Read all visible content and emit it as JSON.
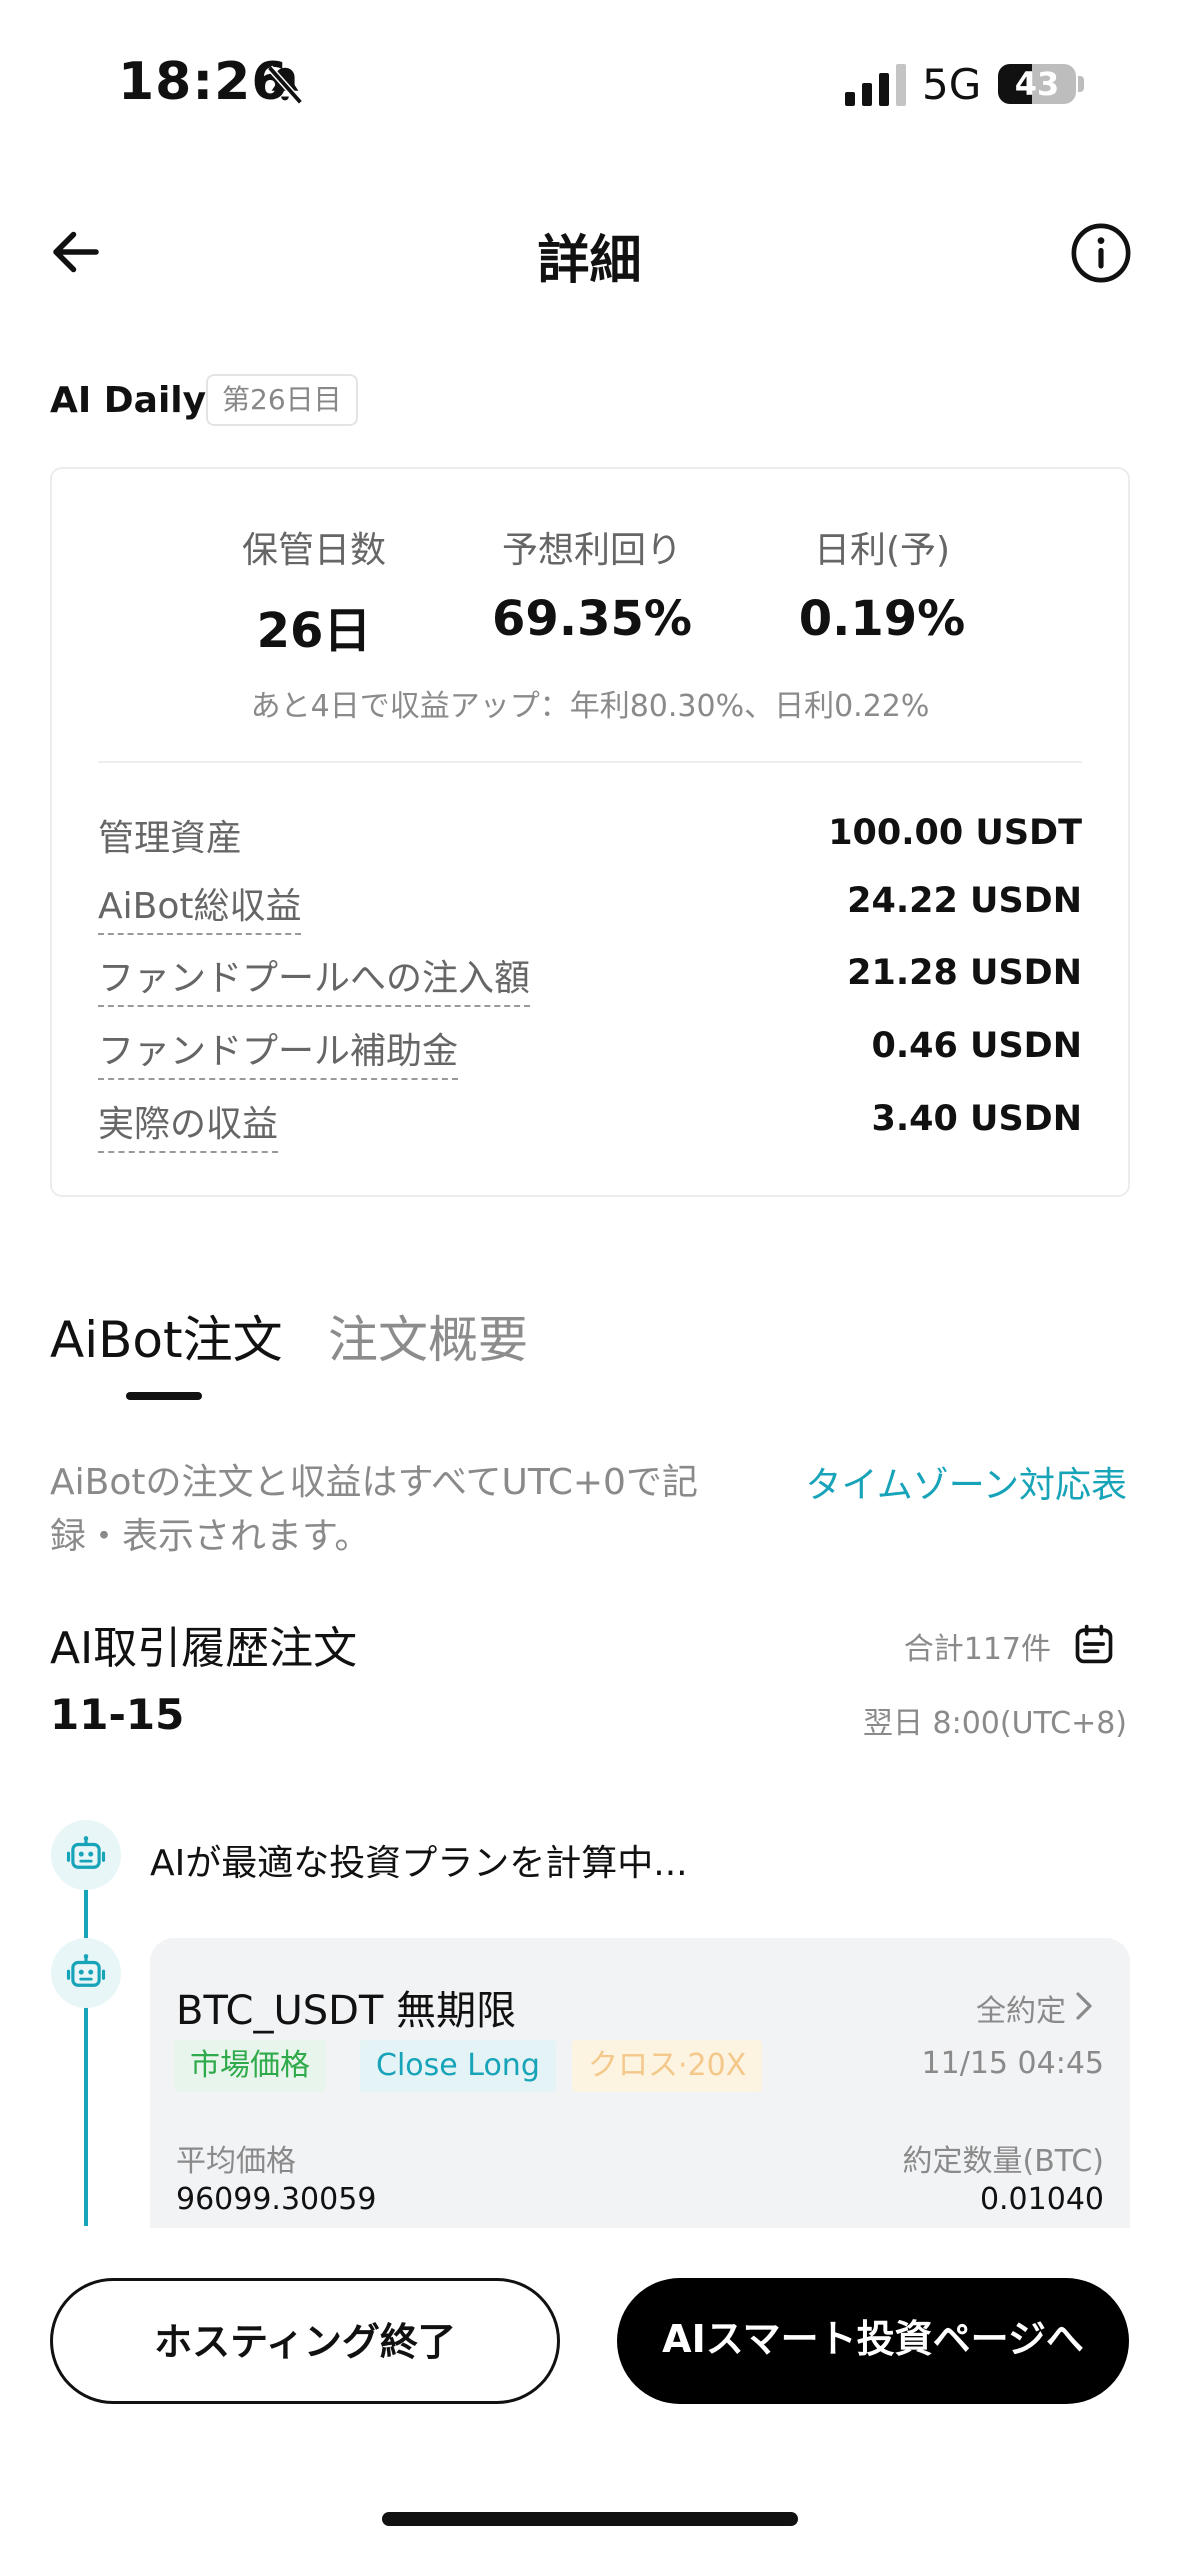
{
  "status_bar": {
    "time": "18:26",
    "network": "5G",
    "battery": "43",
    "battery_level": 0.43
  },
  "nav": {
    "title": "詳細"
  },
  "bot": {
    "name": "AI Daily",
    "day_badge": "第26日目"
  },
  "stats": [
    {
      "label": "保管日数",
      "value": "26日"
    },
    {
      "label": "予想利回り",
      "value": "69.35%"
    },
    {
      "label": "日利(予)",
      "value": "0.19%"
    }
  ],
  "hint": "あと4日で収益アップ：年利80.30%、日利0.22%",
  "details": [
    {
      "label": "管理資産",
      "value": "100.00 USDT"
    },
    {
      "label": "AiBot総収益",
      "value": "24.22 USDN"
    },
    {
      "label": "ファンドプールへの注入額",
      "value": "21.28 USDN"
    },
    {
      "label": "ファンドプール補助金",
      "value": "0.46 USDN"
    },
    {
      "label": "実際の収益",
      "value": "3.40 USDN"
    }
  ],
  "tabs": {
    "orders": "AiBot注文",
    "overview": "注文概要"
  },
  "note": "AiBotの注文と収益はすべてUTC+0で記録・表示されます。",
  "timezone_link": "タイムゾーン対応表",
  "history": {
    "title": "AI取引履歴注文",
    "total": "合計117件",
    "date": "11-15",
    "next_time": "翌日 8:00(UTC+8)"
  },
  "timeline": {
    "calculating": "AIが最適な投資プランを計算中...",
    "order": {
      "pair": "BTC_USDT 無期限",
      "status": "全約定",
      "time": "11/15 04:45",
      "tags": [
        "市場価格",
        "Close Long",
        "クロス·20X"
      ],
      "avg_price_label": "平均価格",
      "avg_price": "96099.30059",
      "qty_label": "約定数量(BTC)",
      "qty": "0.01040"
    }
  },
  "buttons": {
    "end_hosting": "ホスティング終了",
    "go_ai": "AIスマート投資ページへ"
  },
  "colors": {
    "accent": "#17a3b8",
    "green": "#2eaa4a",
    "yellow": "#f3c88a"
  }
}
